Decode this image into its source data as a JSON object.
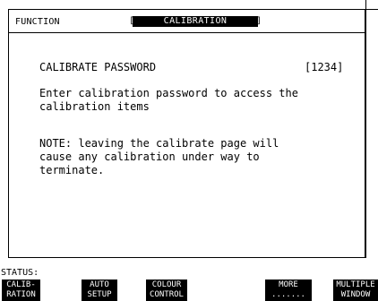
{
  "function": {
    "label": "FUNCTION",
    "bracket_left": "[",
    "value": "CALIBRATION",
    "bracket_right": "]"
  },
  "main": {
    "password_label": "CALIBRATE PASSWORD",
    "password_value": "[1234]",
    "instruction_line1": "Enter calibration password to access the",
    "instruction_line2": "calibration items",
    "note_line1": "NOTE: leaving the calibrate page will",
    "note_line2": "cause any calibration under way to",
    "note_line3": "terminate."
  },
  "status": {
    "label": "STATUS:"
  },
  "softkeys": [
    {
      "line1": "CALIB-",
      "line2": "RATION"
    },
    {
      "line1": "AUTO",
      "line2": "SETUP"
    },
    {
      "line1": "COLOUR",
      "line2": "CONTROL"
    },
    {
      "line1": "MORE",
      "line2": "......."
    },
    {
      "line1": "MULTIPLE",
      "line2": "WINDOW"
    }
  ],
  "colors": {
    "foreground": "#000000",
    "background": "#ffffff"
  }
}
